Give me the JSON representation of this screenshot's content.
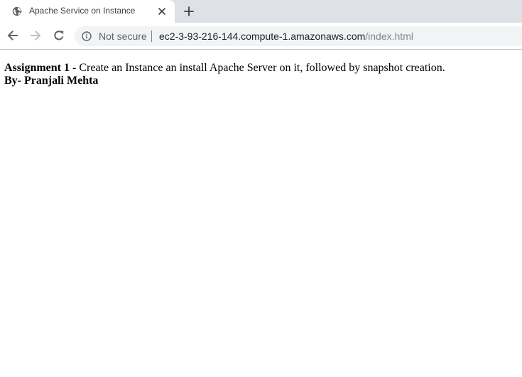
{
  "tab": {
    "title": "Apache Service on Instance",
    "favicon": "globe-icon"
  },
  "omnibox": {
    "security_label": "Not secure",
    "url_host": "ec2-3-93-216-144.compute-1.amazonaws.com",
    "url_path": "/index.html"
  },
  "page": {
    "assignment_label": "Assignment 1",
    "assignment_text": " - Create an Instance an install Apache Server on it, followed by snapshot creation.",
    "author_line": "By- Pranjali Mehta"
  },
  "colors": {
    "tabstrip_bg": "#dee1e6",
    "omnibox_bg": "#f1f3f4",
    "icon_gray": "#5f6368"
  }
}
